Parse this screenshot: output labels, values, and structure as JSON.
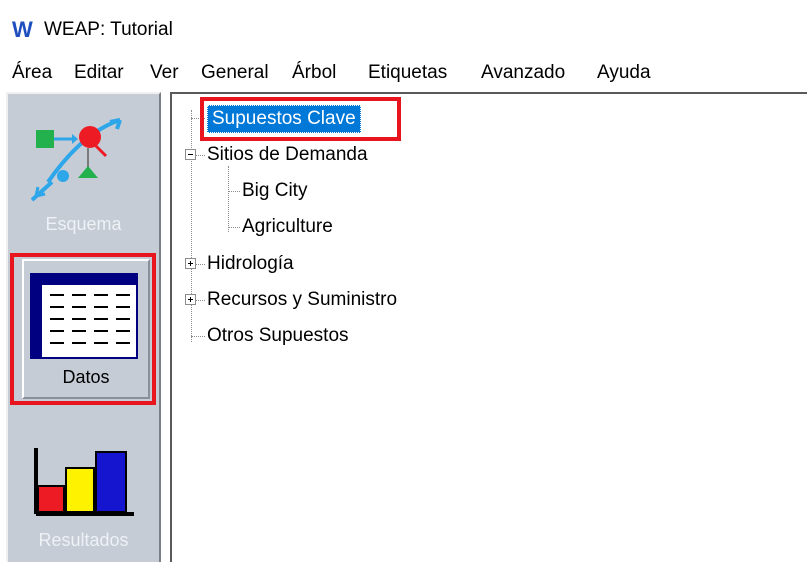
{
  "window": {
    "logo_letter": "W",
    "title": "WEAP: Tutorial"
  },
  "menu": [
    "Área",
    "Editar",
    "Ver",
    "General",
    "Árbol",
    "Etiquetas",
    "Avanzado",
    "Ayuda"
  ],
  "viewbar": {
    "items": [
      {
        "label": "Esquema",
        "icon": "schematic-icon",
        "enabled": false
      },
      {
        "label": "Datos",
        "icon": "data-table-icon",
        "selected": true
      },
      {
        "label": "Resultados",
        "icon": "bar-chart-icon",
        "enabled": false
      }
    ]
  },
  "tree": {
    "nodes": [
      {
        "label": "Supuestos Clave",
        "selected": true
      },
      {
        "label": "Sitios de Demanda",
        "expanded": true
      },
      {
        "label": "Big City"
      },
      {
        "label": "Agriculture"
      },
      {
        "label": "Hidrología",
        "expanded": false
      },
      {
        "label": "Recursos y Suministro",
        "expanded": false
      },
      {
        "label": "Otros Supuestos"
      }
    ]
  },
  "colors": {
    "highlight_box": "#e8141e",
    "selection": "#0078d7",
    "viewbar_bg": "#c5ccd6",
    "logo": "#1f4fbf"
  }
}
